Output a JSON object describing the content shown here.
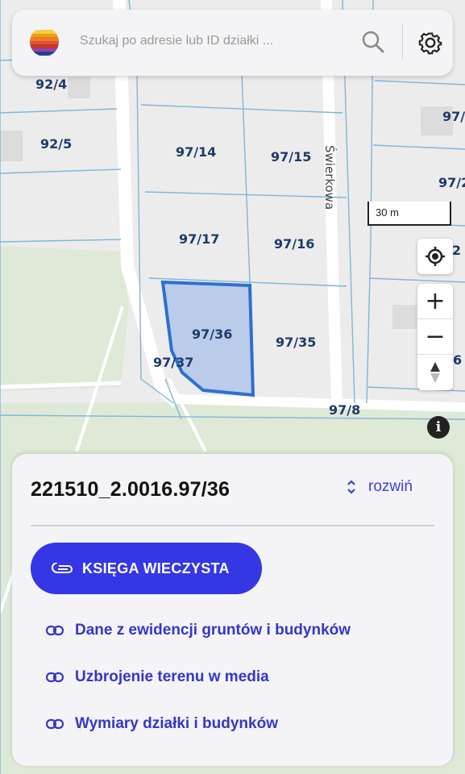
{
  "search": {
    "placeholder": "Szukaj po adresie lub ID działki ..."
  },
  "icons": {
    "logo": "rainbow-logo-icon",
    "search": "search-icon",
    "settings": "gear-icon",
    "locate": "locate-icon",
    "zoom_in": "plus-icon",
    "zoom_out": "minus-icon",
    "compass": "compass-icon",
    "info": "info-icon",
    "link": "link-icon"
  },
  "map": {
    "scale_label": "30 m",
    "street_name": "Świerkowa",
    "zoom_in_label": "+",
    "zoom_out_label": "−",
    "info_label": "i",
    "parcels": [
      "92/4",
      "92/5",
      "97/14",
      "97/15",
      "97/17",
      "97/16",
      "97/36",
      "97/35",
      "97/37",
      "97/8",
      "97/",
      "97/2",
      "/2",
      "6"
    ]
  },
  "panel": {
    "parcel_id": "221510_2.0016.97/36",
    "expand_label": "rozwiń",
    "primary_button": "KSIĘGA WIECZYSTA",
    "links": [
      "Dane z ewidencji gruntów i budynków",
      "Uzbrojenie terenu w media",
      "Wymiary działki i budynków"
    ]
  },
  "colors": {
    "accent": "#3437e3",
    "parcel_line": "#7fb6d6",
    "selected_parcel_fill": "#b5c9ea",
    "selected_parcel_border": "#2f6fd0",
    "green_area": "#dfe9d8"
  }
}
